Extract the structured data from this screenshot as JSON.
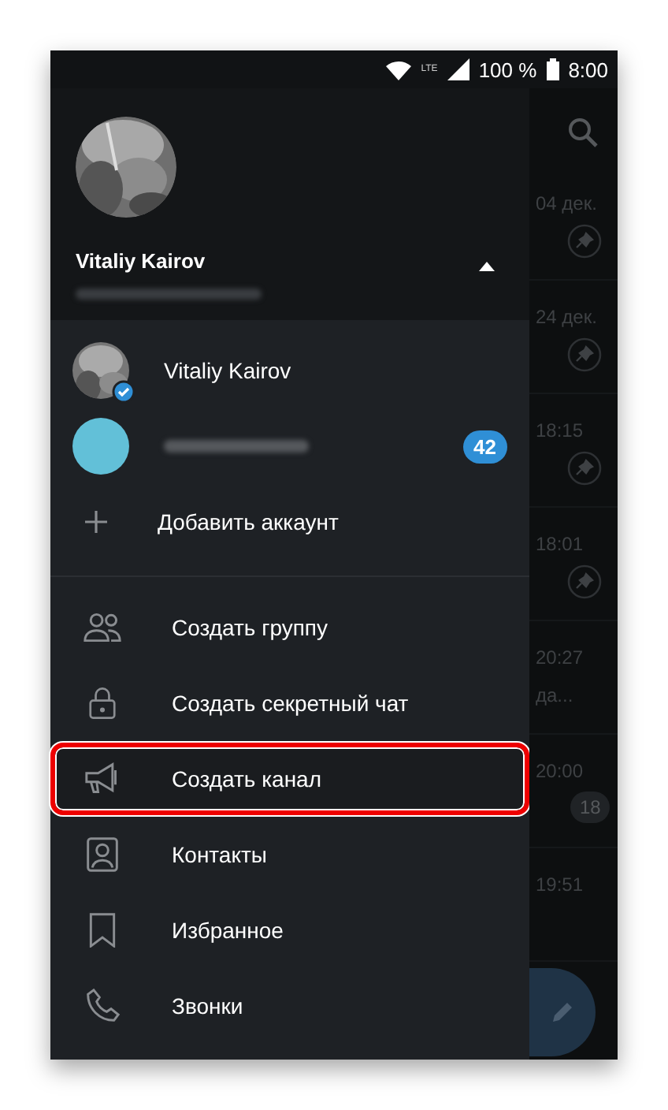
{
  "status_bar": {
    "network": "LTE",
    "battery": "100 %",
    "time": "8:00"
  },
  "drawer": {
    "header": {
      "name": "Vitaliy Kairov",
      "expanded": true
    },
    "accounts": [
      {
        "name": "Vitaliy Kairov",
        "selected": true
      },
      {
        "kind": "blurred",
        "color": "#62c0d8",
        "badge": "42",
        "selected": false
      }
    ],
    "add_account": "Добавить аккаунт",
    "menu": [
      {
        "kind": "people",
        "label": "Создать группу",
        "highlighted": false
      },
      {
        "kind": "lock",
        "label": "Создать секретный чат",
        "highlighted": false
      },
      {
        "kind": "megaphone",
        "label": "Создать канал",
        "highlighted": true
      },
      {
        "kind": "contact",
        "label": "Контакты",
        "highlighted": false
      },
      {
        "kind": "bookmark",
        "label": "Избранное",
        "highlighted": false
      },
      {
        "kind": "phone",
        "label": "Звонки",
        "highlighted": false
      }
    ]
  },
  "chat_list": [
    {
      "time": "04 дек.",
      "kind": "pin"
    },
    {
      "time": "24 дек.",
      "kind": "pin"
    },
    {
      "time": "18:15",
      "kind": "pin"
    },
    {
      "time": "18:01",
      "kind": "pin"
    },
    {
      "time": "20:27",
      "kind": "text",
      "text": "да..."
    },
    {
      "time": "20:00",
      "kind": "badge",
      "text": "18"
    },
    {
      "time": "19:51",
      "kind": "none"
    }
  ]
}
